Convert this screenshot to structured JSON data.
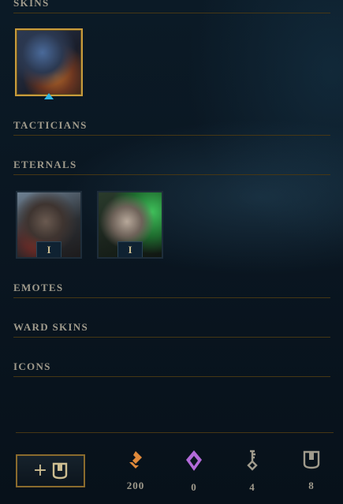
{
  "sections": {
    "skins": "SKINS",
    "tacticians": "TACTICIANS",
    "eternals": "ETERNALS",
    "emotes": "EMOTES",
    "ward_skins": "WARD SKINS",
    "icons": "ICONS"
  },
  "eternals": [
    {
      "badge": "I"
    },
    {
      "badge": "I"
    }
  ],
  "footer": {
    "add_button_plus": "+",
    "currencies": [
      {
        "icon": "orange-essence-icon",
        "amount": "200",
        "color": "#e0893a"
      },
      {
        "icon": "mythic-essence-icon",
        "amount": "0",
        "color": "#b36bd9"
      },
      {
        "icon": "key-fragment-icon",
        "amount": "4",
        "color": "#a09b8c"
      },
      {
        "icon": "chest-icon",
        "amount": "8",
        "color": "#a09b8c"
      }
    ]
  },
  "colors": {
    "gold_border": "#c89b3c",
    "divider": "#463714",
    "text": "#a09b8c",
    "skin_marker": "#2fb7e6"
  }
}
